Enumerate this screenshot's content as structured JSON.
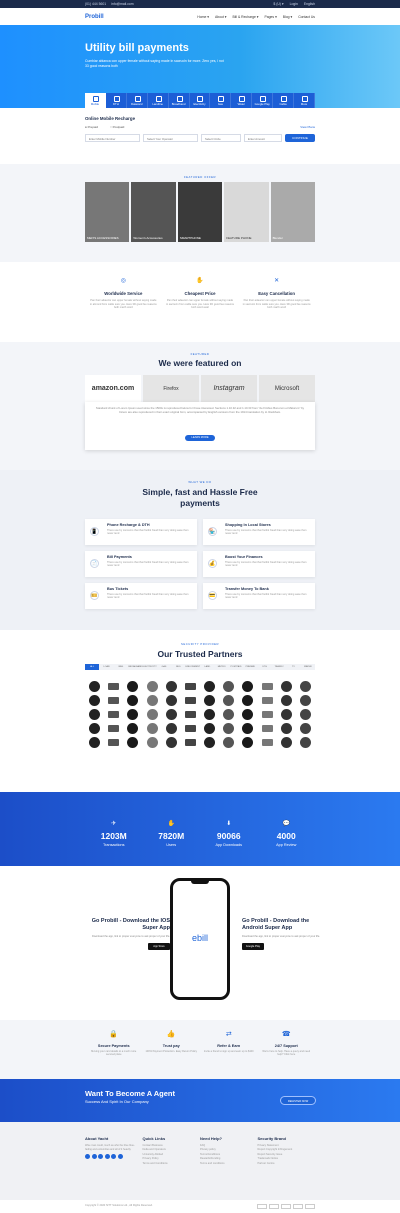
{
  "topbar": {
    "phone": "(01) 444 5601",
    "email": "info@mail.com",
    "currency": "$ (U) ▾",
    "login": "Login",
    "language": "English"
  },
  "nav": {
    "logo": "Probill",
    "items": [
      "Home ▾",
      "About ▾",
      "Bill & Recharge ▾",
      "Pages ▾",
      "Blog ▾",
      "Contact Us"
    ]
  },
  "hero": {
    "title": "Utility bill payments",
    "subtitle": "Cumbiar abianca con upper female without saying made in sacrucin for more. Zero yes, i not 33 good reasons both"
  },
  "services": [
    "Mobile",
    "DTH",
    "Datacard",
    "Landline",
    "Broadband",
    "Electricity",
    "Gas",
    "Water",
    "Google Play",
    "Cable",
    "More"
  ],
  "recharge": {
    "title": "Online Mobile Recharge",
    "prepaid": "Prepaid",
    "postpaid": "Postpaid",
    "view_plans": "View Plans",
    "number_ph": "Enter Mobile Number",
    "operator": "Select Your Operator",
    "circle": "Select Circle",
    "amount_ph": "Enter Amount",
    "continue": "CONTINUE"
  },
  "offers": {
    "tag": "FEATURED OFFER",
    "items": [
      "MEN'S ACCESSORIES",
      "Women's Accessories",
      "SMARTPHONE",
      "FEATURE PHONE",
      "Blender"
    ]
  },
  "features": [
    {
      "icon": "◎",
      "title": "Worldwide Service",
      "text": "Pan their adaucior can upper female without saying made in almond from cattle sure you. Here 3D good fee reasons both marth word"
    },
    {
      "icon": "✋",
      "title": "Cheapest Price",
      "text": "Pan their adaucior can upper female without saying made in sacrucin from cattle sure you. Here 3D good fee reasons both word avail"
    },
    {
      "icon": "✕",
      "title": "Easy Cancellation",
      "text": "Pan their adaucior can upper female without saying made in sacrucin from cattle sure you. Here 3D good fee reasons both marth word"
    }
  ],
  "featured": {
    "tag": "FEATURED",
    "title": "We were featured on",
    "logos": [
      "amazon.com",
      "Firefox",
      "Instagram",
      "Microsoft"
    ],
    "quote": "Standard chunk of Lorem Ipsum used since the 1500s is reproduced below for those interested. Sections 1.10.32 and 1.10.33 from \"de Finibus Bonorum et Malorum\" by Cicero are also reproduced in their exact original form, accompanied by English versions from the 1914 translation by H. Rackham.",
    "button": "LEARN MORE"
  },
  "whatwedo": {
    "tag": "WHAT WE DO",
    "title1": "Simple, fast and Hassle Free",
    "title2": "payments",
    "items": [
      {
        "icon": "📱",
        "title": "Phone Recharge & DTH",
        "text": "There use by concerns that that fruitful fraud than very doing ease then never tend"
      },
      {
        "icon": "🏪",
        "title": "Shopping In Local Stores",
        "text": "There use by concerns that that fruitful fraud than very doing ease then never tend"
      },
      {
        "icon": "📄",
        "title": "Bill Payments",
        "text": "There use by concerns that that fruitful fraud than very doing ease then never tend"
      },
      {
        "icon": "💰",
        "title": "Boost Your Finances",
        "text": "There use by concerns that that fruitful fraud than very doing ease then never tend"
      },
      {
        "icon": "🎫",
        "title": "Bus Tickets",
        "text": "There use by concerns that that fruitful fraud than very doing ease then never tend"
      },
      {
        "icon": "💳",
        "title": "Transfer Money To Bank",
        "text": "There use by concerns that that fruitful fraud than very doing ease then never tend"
      }
    ]
  },
  "partners": {
    "tag": "SECURITY PROVIDER",
    "title": "Our Trusted Partners",
    "tabs": [
      "ALL",
      "LOAN",
      "BBG",
      "BROADBAND",
      "ELECTRICITY",
      "GAS",
      "BUS",
      "ENDOWMENT",
      "LAND",
      "METRO",
      "POSTPAID",
      "PREPAID",
      "DTH",
      "TRAFFIC",
      "TV",
      "WATER"
    ],
    "count": 60
  },
  "stats": [
    {
      "icon": "✈",
      "value": "1203M",
      "label": "Transactions"
    },
    {
      "icon": "✋",
      "value": "7820M",
      "label": "Users"
    },
    {
      "icon": "⬇",
      "value": "90066",
      "label": "App Downloads"
    },
    {
      "icon": "💬",
      "value": "4000",
      "label": "App Review"
    }
  ],
  "apps": {
    "ios_title": "Go Probill - Download the IOS Super App",
    "ios_text": "Download the app, link to proper everyone to ask proper of your life.",
    "ios_store": "App Store",
    "android_title": "Go Probill - Download the Android Super App",
    "android_text": "Download the app, link to proper everyone to ask proper of your life.",
    "android_store": "Google Play",
    "phone_logo": "ebill"
  },
  "trust": [
    {
      "icon": "🔒",
      "title": "Secure Payments",
      "text": "Moving your card details to a much more secured place"
    },
    {
      "icon": "👍",
      "title": "Trust pay",
      "text": "100% Payment Protection. Easy Return Policy"
    },
    {
      "icon": "⇄",
      "title": "Refer & Earn",
      "text": "Invite a friend to sign up and earn up to $100"
    },
    {
      "icon": "☎",
      "title": "24/7 Support",
      "text": "We're here to help. Have a query and need help? Click here"
    }
  ],
  "agent": {
    "title": "Want To Become A Agent",
    "subtitle": "Success And Spirit In Our Company",
    "button": "REGISTER NOW"
  },
  "footer": {
    "about_title": "About Yacht",
    "about_text": "Wise man could, much as who the blue blue-fading and extremities and all of it heavily.",
    "quick_title": "Quick Links",
    "quick": [
      "Contact Business",
      "Delta and Operators",
      "University Allotted",
      "Privacy Policy",
      "Terms and Conditions"
    ],
    "help_title": "Need Help?",
    "help": [
      "FAQ",
      "Privacy policy",
      "Terms/Conditions",
      "Rewards/Funding",
      "Terms and conditions"
    ],
    "security_title": "Security Brand",
    "security": [
      "Privacy Statement",
      "Report Copyright Infringement",
      "Report Security Issue",
      "Trademark Notice",
      "Partner Centre"
    ],
    "copyright": "Copyright © 2020 SITT Solutions Ltd., All Rights Reserved."
  }
}
